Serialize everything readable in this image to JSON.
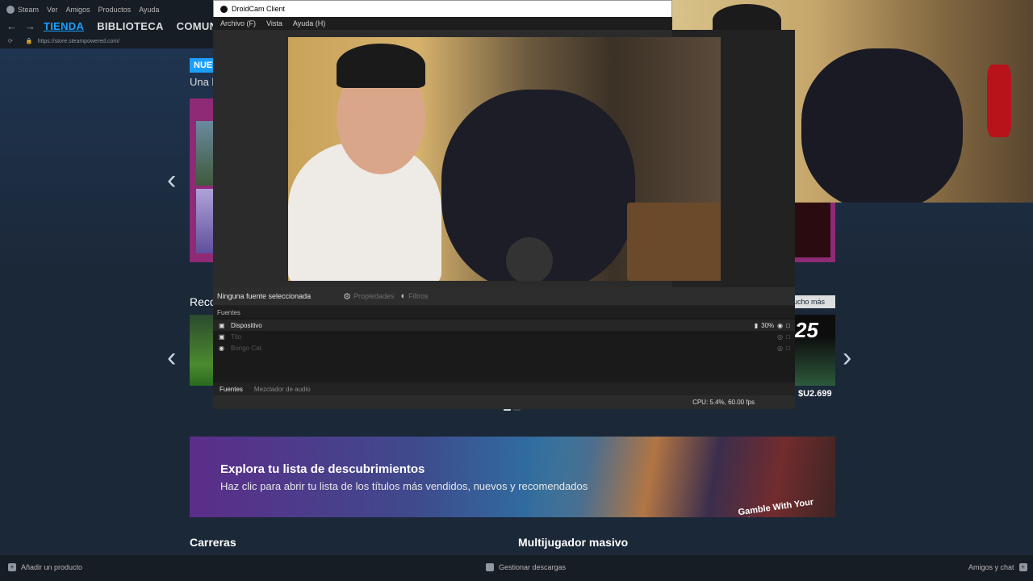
{
  "steam": {
    "menu": [
      "Steam",
      "Ver",
      "Amigos",
      "Productos",
      "Ayuda"
    ],
    "nav_tabs": [
      {
        "label": "TIENDA",
        "active": true
      },
      {
        "label": "BIBLIOTECA",
        "active": false
      },
      {
        "label": "COMUNIDAD",
        "active": false
      }
    ],
    "url": "https://store.steampowered.com/",
    "badge": "NUEV",
    "subtitle": "Una l",
    "recommended_title": "Reco",
    "see_more": "ucho más",
    "price": "$U2.699",
    "game_logo_text": "25",
    "discovery": {
      "title": "Explora tu lista de descubrimientos",
      "subtitle": "Haz clic para abrir tu lista de los títulos más vendidos, nuevos y recomendados",
      "art_text": "Gamble With Your Frien"
    },
    "sections": [
      "Carreras",
      "Multijugador masivo"
    ],
    "bottom": {
      "add_product": "Añadir un producto",
      "downloads": "Gestionar descargas",
      "friends": "Amigos y chat"
    }
  },
  "droidcam": {
    "title": "DroidCam Client",
    "menu": [
      "Archivo (F)",
      "Vista",
      "Ayuda (H)"
    ],
    "no_source": "Ninguna fuente seleccionada",
    "properties": "Propiedades",
    "filters": "Filtros",
    "sources_header": "Fuentes",
    "sources": [
      {
        "name": "Dispositivo",
        "icon": "camera-icon",
        "active": true,
        "level": "30%"
      },
      {
        "name": "Tito",
        "icon": "camera-icon",
        "active": false,
        "level": ""
      },
      {
        "name": "Bongo Cat",
        "icon": "gamepad-icon",
        "active": false,
        "level": ""
      }
    ],
    "tabs": [
      "Fuentes",
      "Mezclador de audio"
    ],
    "status": "CPU: 5.4%, 60.00 fps"
  },
  "colors": {
    "steam_bg": "#1b2838",
    "steam_accent": "#1a9fff",
    "droidcam_bg": "#222222"
  }
}
